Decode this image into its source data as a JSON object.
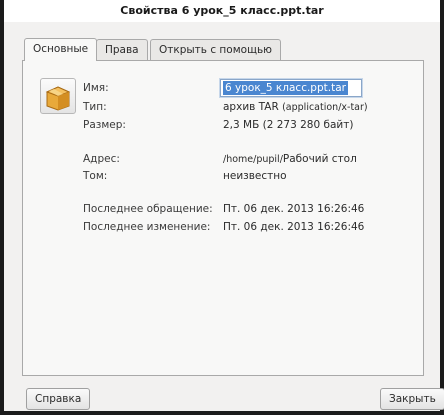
{
  "window": {
    "title": "Свойства 6 урок_5 класс.ppt.tar"
  },
  "tabs": [
    {
      "label": "Основные"
    },
    {
      "label": "Права"
    },
    {
      "label": "Открыть с помощью"
    }
  ],
  "general": {
    "icon": "package-archive-icon",
    "name_label": "Имя:",
    "name_value": "6 урок_5 класс.ppt.tar",
    "type_label": "Тип:",
    "type_value_main": "архив TAR",
    "type_value_mime": "(application/x-tar)",
    "size_label": "Размер:",
    "size_value": "2,3 МБ (2 273 280 байт)",
    "location_label": "Адрес:",
    "location_path": "/home/pupil/",
    "location_folder": "Рабочий стол",
    "volume_label": "Том:",
    "volume_value": "неизвестно",
    "accessed_label": "Последнее обращение:",
    "accessed_value": "Пт. 06 дек. 2013 16:26:46",
    "modified_label": "Последнее изменение:",
    "modified_value": "Пт. 06 дек. 2013 16:26:46"
  },
  "buttons": {
    "help": "Справка",
    "close": "Закрыть"
  },
  "colors": {
    "selection": "#4a86d0",
    "icon_box": "#e8a93a"
  }
}
